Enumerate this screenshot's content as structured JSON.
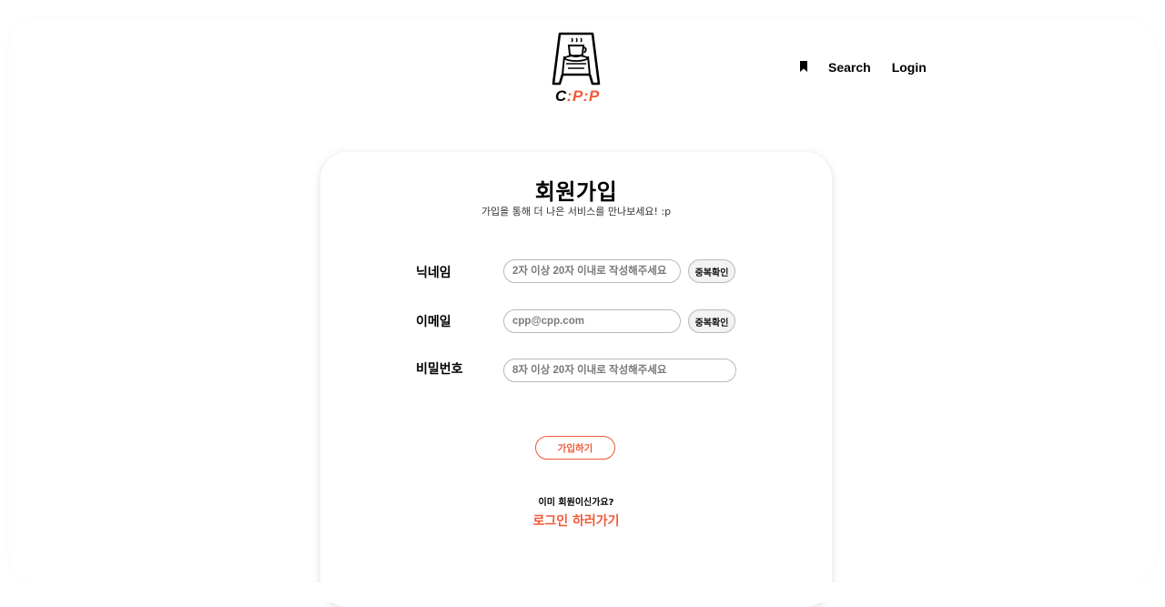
{
  "header": {
    "logo_text": "C:P:P",
    "nav": {
      "bookmark_icon": "bookmark-icon",
      "search_label": "Search",
      "login_label": "Login"
    }
  },
  "signup": {
    "title": "회원가입",
    "subtitle": "가입을 통해 더 나은 서비스를 만나보세요! :p",
    "fields": {
      "nickname": {
        "label": "닉네임",
        "placeholder": "2자 이상 20자 이내로 작성해주세요",
        "check_button": "중복확인"
      },
      "email": {
        "label": "이메일",
        "placeholder": "cpp@cpp.com",
        "check_button": "중복확인"
      },
      "password": {
        "label": "비밀번호",
        "placeholder": "8자 이상 20자 이내로 작성해주세요"
      }
    },
    "submit_label": "가입하기",
    "already_member_text": "이미 회원이신가요?",
    "login_link_text": "로그인 하러가기"
  },
  "colors": {
    "accent": "#ef5a3a",
    "text": "#000000",
    "border": "#b9b9b9"
  }
}
